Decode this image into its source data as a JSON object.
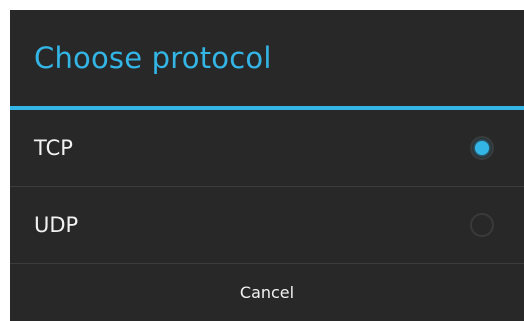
{
  "dialog": {
    "title": "Choose protocol",
    "options": [
      {
        "label": "TCP",
        "selected": true
      },
      {
        "label": "UDP",
        "selected": false
      }
    ],
    "cancel_label": "Cancel"
  },
  "colors": {
    "accent": "#33b5e5",
    "background": "#282828",
    "text": "#f2f2f2",
    "divider": "#3c3c3c"
  },
  "icons": {
    "selected": "radio-checked-icon",
    "unselected": "radio-unchecked-icon"
  }
}
